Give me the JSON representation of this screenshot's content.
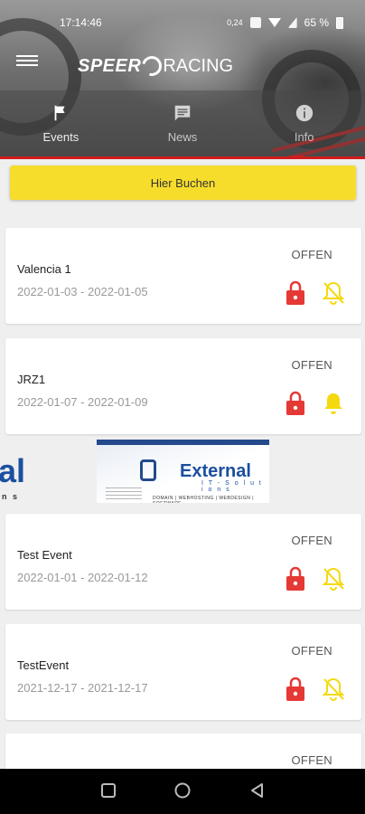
{
  "status_bar": {
    "time": "17:14:46",
    "speed": "0,24",
    "battery": "65 %"
  },
  "header": {
    "logo_speer": "SPEER",
    "logo_racing": "RACING",
    "tabs": [
      {
        "label": "Events",
        "icon": "flag-icon",
        "active": true
      },
      {
        "label": "News",
        "icon": "message-icon",
        "active": false
      },
      {
        "label": "Info",
        "icon": "info-icon",
        "active": false
      }
    ]
  },
  "book_button": {
    "label": "Hier Buchen"
  },
  "events": [
    {
      "name": "Valencia 1",
      "dates": "2022-01-03 - 2022-01-05",
      "status": "OFFEN",
      "bell": "bell-off-icon"
    },
    {
      "name": "JRZ1",
      "dates": "2022-01-07 - 2022-01-09",
      "status": "OFFEN",
      "bell": "bell-icon"
    },
    {
      "name": "Test Event",
      "dates": "2022-01-01 - 2022-01-12",
      "status": "OFFEN",
      "bell": "bell-off-icon"
    },
    {
      "name": "TestEvent",
      "dates": "2021-12-17 - 2021-12-17",
      "status": "OFFEN",
      "bell": "bell-off-icon"
    },
    {
      "name": "",
      "dates": "",
      "status": "OFFEN",
      "bell": "bell-off-icon"
    }
  ],
  "banner": {
    "left_fragment": "al",
    "left_sub": "n s",
    "name": "External",
    "subtitle": "I T - S o l u t i o n s",
    "services": "DOMAIN | WEBHOSTING | WEBDESIGN | SOFTWARE"
  },
  "colors": {
    "accent_yellow": "#f7dd2b",
    "lock_red": "#e53935",
    "bell_yellow": "#f5d90f",
    "brand_blue": "#1b4fa0"
  }
}
